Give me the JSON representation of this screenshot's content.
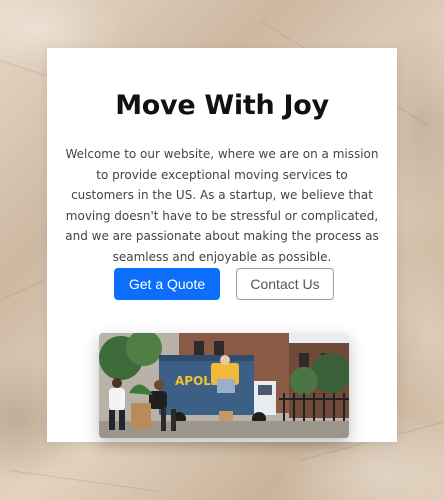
{
  "hero": {
    "title": "Move With Joy",
    "description": "Welcome to our website, where we are on a mission to provide exceptional moving services to customers in the US. As a startup, we believe that moving doesn't have to be stressful or complicated, and we are passionate about making the process as seamless and enjoyable as possible."
  },
  "buttons": {
    "quote_label": "Get a Quote",
    "contact_label": "Contact Us"
  },
  "photo": {
    "truck_text": "APOLIS",
    "icon": "moving-truck-photo"
  },
  "colors": {
    "primary": "#0d6efd",
    "background": "#d9c7b3",
    "card": "#ffffff"
  }
}
